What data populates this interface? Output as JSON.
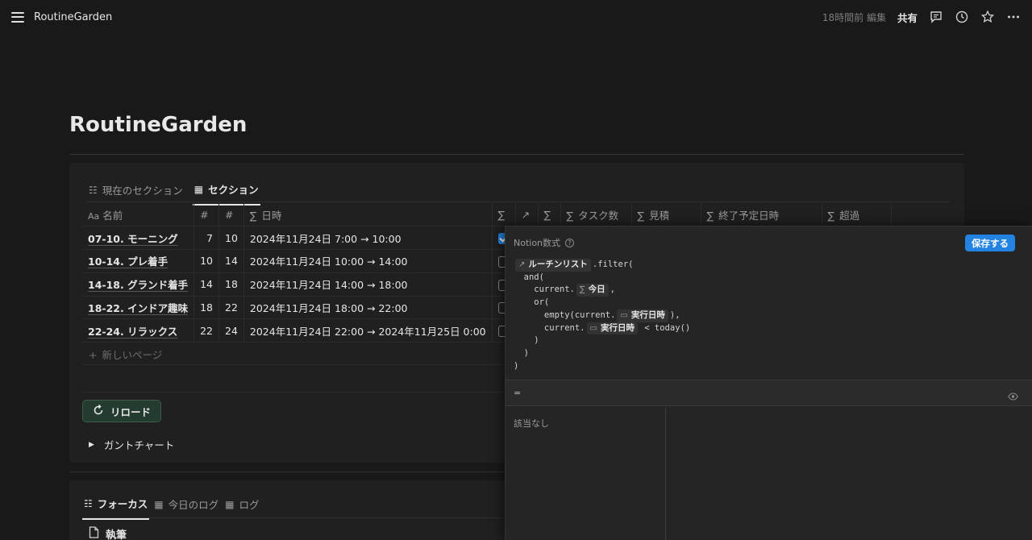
{
  "topbar": {
    "breadcrumb": "RoutineGarden",
    "edited": "18時間前 編集",
    "share": "共有"
  },
  "page": {
    "title": "RoutineGarden"
  },
  "db": {
    "tabs": [
      {
        "label": "現在のセクション",
        "icon": "list-icon"
      },
      {
        "label": "セクション",
        "icon": "table-icon"
      }
    ],
    "columns": {
      "name": "名前",
      "name_prefix": "Aa",
      "num1": "#",
      "num2": "#",
      "datetime": "日時",
      "sigma": "∑",
      "arrow": "↗",
      "sigma2": "∑",
      "tasks": "タスク数",
      "estimate": "見積",
      "end": "終了予定日時",
      "over": "超過",
      "sigma_prefix": "∑"
    },
    "rows": [
      {
        "name": "07-10. モーニング",
        "start": "7",
        "end": "10",
        "datetime": "2024年11月24日 7:00 → 10:00",
        "checked": true
      },
      {
        "name": "10-14. プレ着手",
        "start": "10",
        "end": "14",
        "datetime": "2024年11月24日 10:00 → 14:00",
        "checked": false
      },
      {
        "name": "14-18. グランド着手",
        "start": "14",
        "end": "18",
        "datetime": "2024年11月24日 14:00 → 18:00",
        "checked": false
      },
      {
        "name": "18-22. インドア趣味",
        "start": "18",
        "end": "22",
        "datetime": "2024年11月24日 18:00 → 22:00",
        "checked": false
      },
      {
        "name": "22-24. リラックス",
        "start": "22",
        "end": "24",
        "datetime": "2024年11月24日 22:00 → 2024年11月25日 0:00",
        "checked": false
      }
    ],
    "new_page": "新しいページ",
    "reload_label": "リロード",
    "gantt_label": "ガントチャート"
  },
  "second": {
    "tabs": [
      {
        "label": "フォーカス",
        "icon": "list-icon"
      },
      {
        "label": "今日のログ",
        "icon": "table-icon"
      },
      {
        "label": "ログ",
        "icon": "table-icon"
      }
    ],
    "item": "執筆"
  },
  "formula": {
    "header": "Notion数式",
    "save": "保存する",
    "line1_chip": "ルーチンリスト",
    "line1_rest": ".filter(",
    "line2": "  and(",
    "line3_pre": "    current.",
    "line3_chip": "今日",
    "line3_post": ",",
    "line4": "    or(",
    "line5_pre": "      empty(current.",
    "line5_chip": "実行日時",
    "line5_post": "),",
    "line6_pre": "      current.",
    "line6_chip": "実行日時",
    "line6_post": " < today()",
    "line7": "    )",
    "line8": "  )",
    "line9": ")",
    "equals": "=",
    "no_result": "該当なし"
  },
  "colors": {
    "accent": "#2383e2",
    "bg": "#191919",
    "card": "#202020",
    "reload_bg": "#243b2f"
  }
}
